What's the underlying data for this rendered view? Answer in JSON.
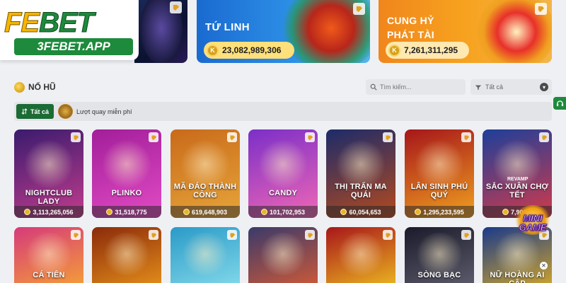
{
  "logo": {
    "main_a": "FE",
    "main_b": "BET",
    "sub": "3FEBET.APP"
  },
  "banners": [
    {
      "title": "TỨ LINH",
      "amount": "23,082,989,306"
    },
    {
      "title": "CUNG HỶ PHÁT TÀI",
      "amount": "7,261,311,295"
    }
  ],
  "section": {
    "title": "NỔ HŨ"
  },
  "search": {
    "placeholder": "Tìm kiếm..."
  },
  "sort_select": {
    "value": "Tất cả"
  },
  "filters": {
    "all_label": "Tất cả",
    "free_spin_label": "Lượt quay miễn phí"
  },
  "games_row1": [
    {
      "name": "NIGHTCLUB LADY",
      "jackpot": "3,113,265,056",
      "color_a": "#3a1b6e",
      "color_b": "#c23c8d"
    },
    {
      "name": "PLINKO",
      "jackpot": "31,518,775",
      "color_a": "#a21e9a",
      "color_b": "#e24bc4"
    },
    {
      "name": "MÃ ĐÁO THÀNH CÔNG",
      "jackpot": "619,648,903",
      "color_a": "#c96a1a",
      "color_b": "#e7a53a"
    },
    {
      "name": "CANDY",
      "jackpot": "101,702,953",
      "color_a": "#7b2fc8",
      "color_b": "#f067b5"
    },
    {
      "name": "THỊ TRẤN MA QUÁI",
      "jackpot": "60,054,653",
      "color_a": "#1c2b6a",
      "color_b": "#b44a1e"
    },
    {
      "name": "LÂN SINH PHÚ QUÝ",
      "jackpot": "1,295,233,595",
      "color_a": "#a6161a",
      "color_b": "#f0a020"
    },
    {
      "name": "SẮC XUÂN CHỢ TẾT",
      "jackpot": "7,900,8",
      "color_a": "#1d3f9a",
      "color_b": "#d23a4a"
    }
  ],
  "revamp_label": "REVAMP",
  "games_row2": [
    {
      "name": "CÁ TIÊN",
      "color_a": "#d63a7a",
      "color_b": "#f39a3a"
    },
    {
      "name": "",
      "color_a": "#8a2a0a",
      "color_b": "#e08a1a"
    },
    {
      "name": "",
      "color_a": "#2a9ac8",
      "color_b": "#7fd6e8"
    },
    {
      "name": "",
      "color_a": "#3a3a6a",
      "color_b": "#c8583a"
    },
    {
      "name": "",
      "color_a": "#a8161a",
      "color_b": "#e8b020"
    },
    {
      "name": "SÒNG BẠC",
      "color_a": "#1a1a2a",
      "color_b": "#5a5a6a"
    },
    {
      "name": "NỮ HOÀNG AI CẬP",
      "color_a": "#1a3a8a",
      "color_b": "#c8a030"
    }
  ],
  "minigame": {
    "text_a": "MINI",
    "text_b": "GAME"
  }
}
